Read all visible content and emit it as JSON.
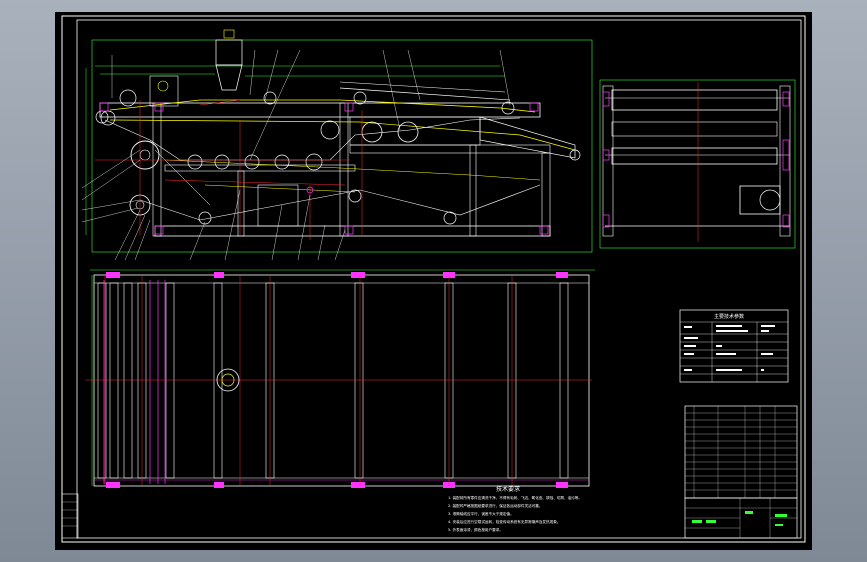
{
  "drawing": {
    "background_color": "#000000",
    "frame_color": "#ffffff",
    "accent_colors": {
      "white": "#ffffff",
      "red": "#ff2a2a",
      "green": "#33ff33",
      "yellow": "#ffff00",
      "magenta": "#ff33ff",
      "cyan": "#33ffff",
      "blue": "#3a6bff"
    }
  },
  "technical_notes": {
    "title": "技术要求",
    "lines": [
      "1. 装配前所有零件应清洗干净，不得有毛刺、飞边、氧化皮、锈蚀、切屑、油污等。",
      "2. 装配时严格按图纸要求进行，保证各运动部件灵活可靠。",
      "3. 滚筒轴线应平行，误差不大于规定值。",
      "4. 安装后应进行空载试运转，检查传动系统有无异常噪声及发热现象。",
      "5. 外表面涂漆，颜色按用户要求。"
    ]
  },
  "specification_table": {
    "title": "主要技术参数"
  }
}
